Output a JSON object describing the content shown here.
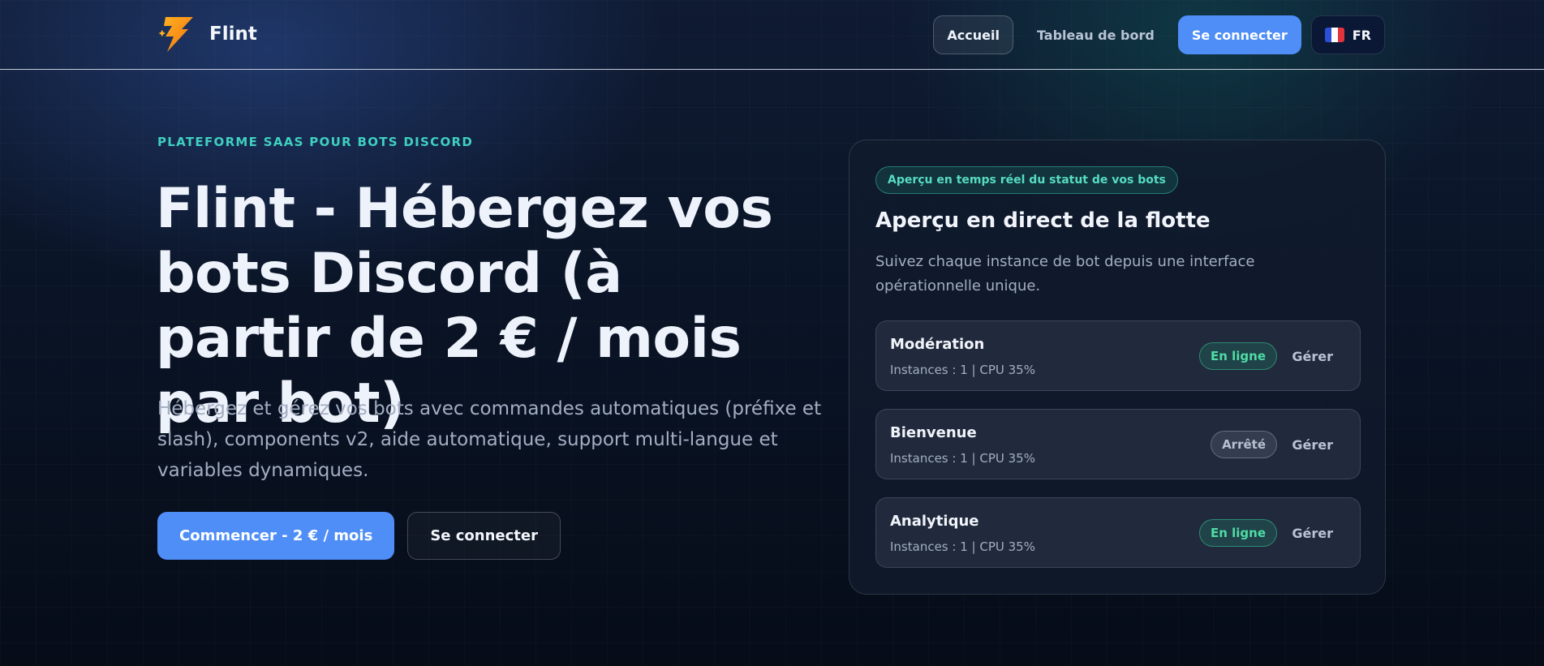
{
  "header": {
    "brand_name": "Flint",
    "nav": {
      "home": "Accueil",
      "dashboard": "Tableau de bord",
      "login": "Se connecter",
      "lang": "FR"
    }
  },
  "hero": {
    "eyebrow": "PLATEFORME SAAS POUR BOTS DISCORD",
    "title": "Flint - Hébergez vos bots Discord (à partir de 2 € / mois par bot)",
    "description": "Hébergez et gérez vos bots avec commandes automatiques (préfixe et slash), components v2, aide automatique, support multi-langue et variables dynamiques.",
    "cta_primary": "Commencer - 2 € / mois",
    "cta_secondary": "Se connecter"
  },
  "panel": {
    "badge": "Aperçu en temps réel du statut de vos bots",
    "title": "Aperçu en direct de la flotte",
    "subtitle": "Suivez chaque instance de bot depuis une interface opérationnelle unique.",
    "bots": [
      {
        "name": "Modération",
        "meta": "Instances : 1 | CPU 35%",
        "status": "En ligne",
        "manage": "Gérer"
      },
      {
        "name": "Bienvenue",
        "meta": "Instances : 1 | CPU 35%",
        "status": "Arrêté",
        "manage": "Gérer"
      },
      {
        "name": "Analytique",
        "meta": "Instances : 1 | CPU 35%",
        "status": "En ligne",
        "manage": "Gérer"
      }
    ]
  },
  "colors": {
    "accent": "#4f8ef7",
    "eyebrow": "#3fcfc0",
    "online": "#4fdca5",
    "stopped": "#b7c0cf"
  },
  "icons": {
    "brand_logo": "lightning-bolt-icon",
    "language_flag": "france-flag-icon"
  }
}
